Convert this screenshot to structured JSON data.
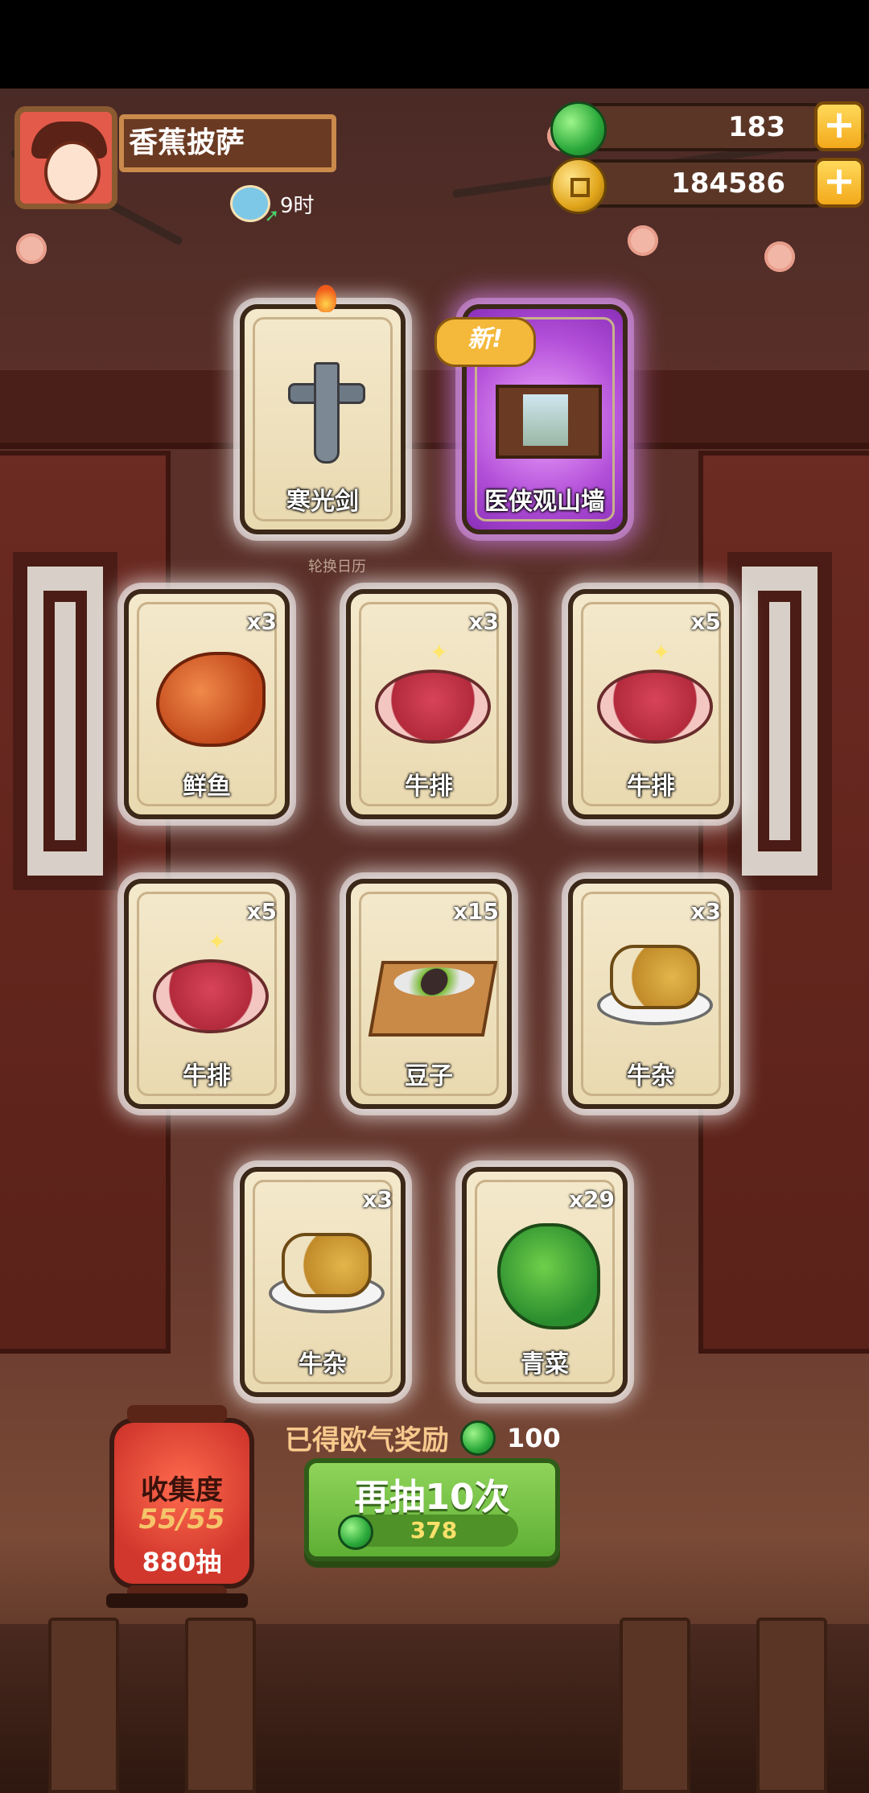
{
  "player": {
    "name": "香蕉披萨",
    "time_label": "9时"
  },
  "resources": {
    "jade": "183",
    "coins": "184586",
    "plus": "+"
  },
  "rotate_calendar": "轮换日历",
  "cards": [
    {
      "label": "寒光剑",
      "qty": "",
      "art": "sword-icon"
    },
    {
      "label": "医侠观山墙",
      "qty": "",
      "art": "wall-decor-icon",
      "badge": "新!"
    },
    {
      "label": "鲜鱼",
      "qty": "x3",
      "art": "fish-icon"
    },
    {
      "label": "牛排",
      "qty": "x3",
      "art": "steak-icon"
    },
    {
      "label": "牛排",
      "qty": "x5",
      "art": "steak-icon"
    },
    {
      "label": "牛排",
      "qty": "x5",
      "art": "steak-icon"
    },
    {
      "label": "豆子",
      "qty": "x15",
      "art": "beans-tray-icon"
    },
    {
      "label": "牛杂",
      "qty": "x3",
      "art": "beef-offal-plate-icon"
    },
    {
      "label": "牛杂",
      "qty": "x3",
      "art": "beef-offal-plate-icon"
    },
    {
      "label": "青菜",
      "qty": "x29",
      "art": "greens-icon"
    }
  ],
  "reward": {
    "label": "已得欧气奖励",
    "value": "100"
  },
  "draw_button": {
    "title": "再抽10次",
    "cost": "378"
  },
  "collection": {
    "title": "收集度",
    "progress": "55/55",
    "draws": "880抽"
  },
  "colors": {
    "draw_green": "#6fbf3f",
    "lantern_red": "#d93a2e",
    "jade_green": "#2aa83a",
    "coin_gold": "#e1a51b"
  }
}
